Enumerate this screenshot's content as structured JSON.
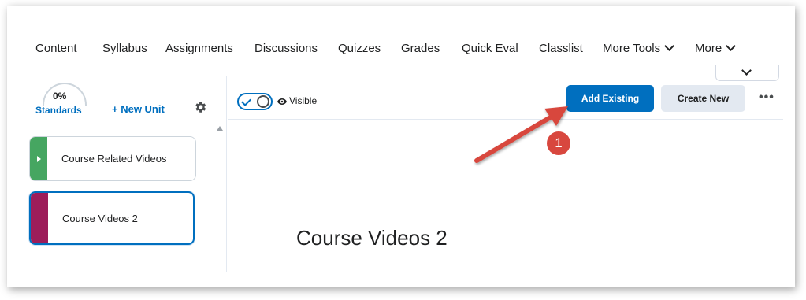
{
  "nav": {
    "items": [
      "Content",
      "Syllabus",
      "Assignments",
      "Discussions",
      "Quizzes",
      "Grades",
      "Quick Eval",
      "Classlist"
    ],
    "more_tools": "More Tools",
    "more": "More"
  },
  "sidebar": {
    "progress": "0%",
    "standards": "Standards",
    "new_unit": "+ New Unit",
    "units": [
      {
        "label": "Course Related Videos",
        "color": "#46a661"
      },
      {
        "label": "Course Videos 2",
        "color": "#9d1d5a"
      }
    ]
  },
  "toolbar": {
    "visible_label": "Visible",
    "add_existing": "Add Existing",
    "create_new": "Create New",
    "more_actions": "•••"
  },
  "main": {
    "title": "Course Videos 2"
  },
  "annotation": {
    "step": "1",
    "color": "#d8473e"
  },
  "colors": {
    "accent": "#006fbf"
  }
}
